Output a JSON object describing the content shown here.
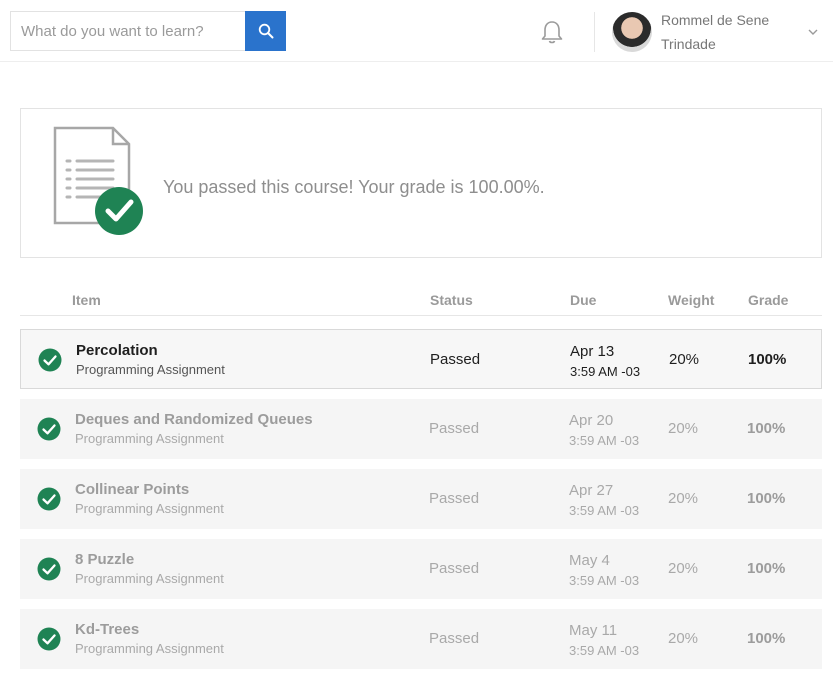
{
  "header": {
    "search_placeholder": "What do you want to learn?",
    "search_icon": "search-icon",
    "bell_icon": "bell-icon",
    "user_name": "Rommel de Sene Trindade",
    "chevron_icon": "chevron-down-icon"
  },
  "banner": {
    "message": "You passed this course! Your grade is 100.00%.",
    "icon": "document-check-icon"
  },
  "table": {
    "headers": {
      "item": "Item",
      "status": "Status",
      "due": "Due",
      "weight": "Weight",
      "grade": "Grade"
    },
    "rows": [
      {
        "title": "Percolation",
        "type": "Programming Assignment",
        "status": "Passed",
        "due_date": "Apr 13",
        "due_time": "3:59 AM -03",
        "weight": "20%",
        "grade": "100%"
      },
      {
        "title": "Deques and Randomized Queues",
        "type": "Programming Assignment",
        "status": "Passed",
        "due_date": "Apr 20",
        "due_time": "3:59 AM -03",
        "weight": "20%",
        "grade": "100%"
      },
      {
        "title": "Collinear Points",
        "type": "Programming Assignment",
        "status": "Passed",
        "due_date": "Apr 27",
        "due_time": "3:59 AM -03",
        "weight": "20%",
        "grade": "100%"
      },
      {
        "title": "8 Puzzle",
        "type": "Programming Assignment",
        "status": "Passed",
        "due_date": "May 4",
        "due_time": "3:59 AM -03",
        "weight": "20%",
        "grade": "100%"
      },
      {
        "title": "Kd-Trees",
        "type": "Programming Assignment",
        "status": "Passed",
        "due_date": "May 11",
        "due_time": "3:59 AM -03",
        "weight": "20%",
        "grade": "100%"
      }
    ]
  },
  "colors": {
    "accent": "#2a73cc",
    "success": "#1f8354"
  }
}
